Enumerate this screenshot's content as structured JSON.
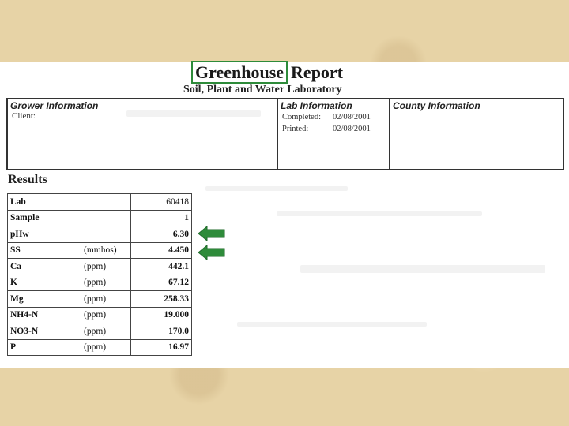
{
  "report": {
    "title_highlight": "Greenhouse",
    "title_rest": "Report",
    "subtitle": "Soil, Plant and Water Laboratory"
  },
  "grower": {
    "heading": "Grower Information",
    "client_label": "Client:"
  },
  "lab": {
    "heading": "Lab Information",
    "completed_label": "Completed:",
    "completed": "02/08/2001",
    "printed_label": "Printed:",
    "printed": "02/08/2001"
  },
  "county": {
    "heading": "County Information"
  },
  "results": {
    "heading": "Results",
    "rows": [
      {
        "name": "Lab",
        "unit": "",
        "value": "60418"
      },
      {
        "name": "Sample",
        "unit": "",
        "value": "1"
      },
      {
        "name": "pHw",
        "unit": "",
        "value": "6.30"
      },
      {
        "name": "SS",
        "unit": "(mmhos)",
        "value": "4.450"
      },
      {
        "name": "Ca",
        "unit": "(ppm)",
        "value": "442.1"
      },
      {
        "name": "K",
        "unit": "(ppm)",
        "value": "67.12"
      },
      {
        "name": "Mg",
        "unit": "(ppm)",
        "value": "258.33"
      },
      {
        "name": "NH4-N",
        "unit": "(ppm)",
        "value": "19.000"
      },
      {
        "name": "NO3-N",
        "unit": "(ppm)",
        "value": "170.0"
      },
      {
        "name": "P",
        "unit": "(ppm)",
        "value": "16.97"
      }
    ]
  },
  "colors": {
    "highlight": "#2e8b3a",
    "arrow": "#2e8b3a",
    "background": "#e7d3a6"
  }
}
